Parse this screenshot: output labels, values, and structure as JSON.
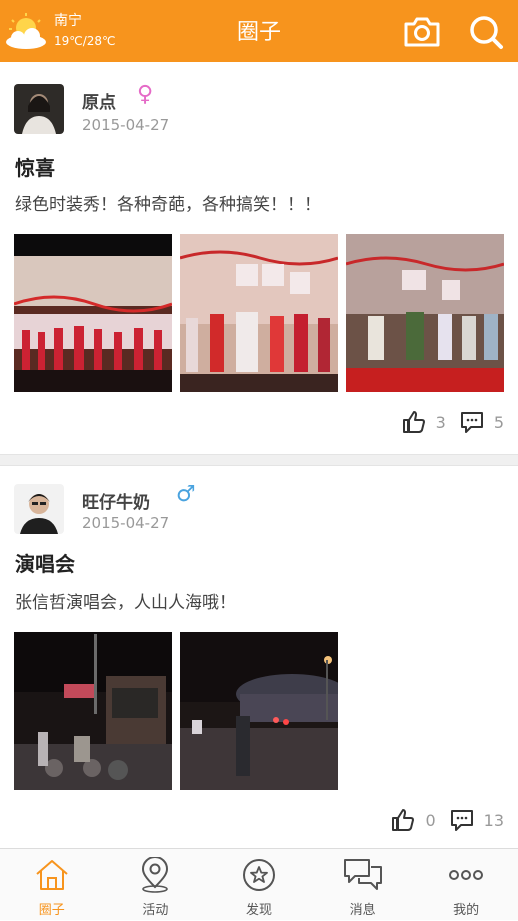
{
  "header": {
    "city": "南宁",
    "temperature": "19℃/28℃",
    "title": "圈子",
    "accent": "#f7941d"
  },
  "posts": [
    {
      "user": "原点",
      "gender": "female",
      "gender_symbol": "♀",
      "gender_color": "#e56ac7",
      "date": "2015-04-27",
      "title": "惊喜",
      "text": "绿色时装秀！各种奇葩，各种搞笑！！！",
      "likes": "3",
      "comments": "5",
      "photos": [
        "stage-fashion-show-1",
        "stage-fashion-show-2",
        "stage-fashion-show-3"
      ]
    },
    {
      "user": "旺仔牛奶",
      "gender": "male",
      "gender_symbol": "♂",
      "gender_color": "#4aa3df",
      "date": "2015-04-27",
      "title": "演唱会",
      "text": "张信哲演唱会，人山人海哦！",
      "likes": "0",
      "comments": "13",
      "photos": [
        "night-crowd-1",
        "night-crowd-2"
      ]
    }
  ],
  "tabbar": {
    "items": [
      {
        "label": "圈子",
        "icon": "home-icon",
        "active": true
      },
      {
        "label": "活动",
        "icon": "location-pin-icon",
        "active": false
      },
      {
        "label": "发现",
        "icon": "star-circle-icon",
        "active": false
      },
      {
        "label": "消息",
        "icon": "chat-bubbles-icon",
        "active": false
      },
      {
        "label": "我的",
        "icon": "more-dots-icon",
        "active": false
      }
    ]
  }
}
